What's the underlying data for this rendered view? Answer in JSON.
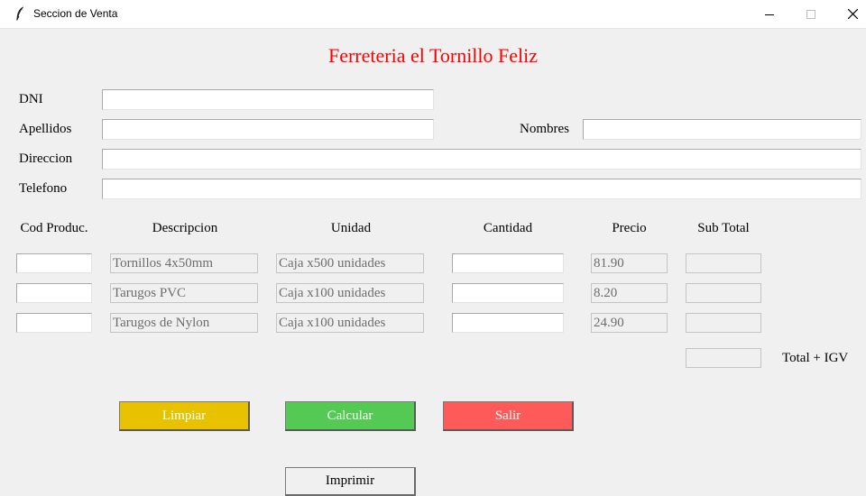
{
  "window": {
    "title": "Seccion de Venta"
  },
  "heading": "Ferreteria el Tornillo Feliz",
  "colors": {
    "heading": "#ff0000",
    "limpiar": "#e8c100",
    "calcular": "#54c954",
    "salir": "#ff5a5a"
  },
  "customer": {
    "dni_label": "DNI",
    "apellidos_label": "Apellidos",
    "nombres_label": "Nombres",
    "direccion_label": "Direccion",
    "telefono_label": "Telefono",
    "dni_value": "",
    "apellidos_value": "",
    "nombres_value": "",
    "direccion_value": "",
    "telefono_value": ""
  },
  "table": {
    "headers": [
      "Cod Produc.",
      "Descripcion",
      "Unidad",
      "Cantidad",
      "Precio",
      "Sub Total"
    ],
    "rows": [
      {
        "cod": "",
        "descripcion": "Tornillos 4x50mm",
        "unidad": "Caja x500 unidades",
        "cantidad": "",
        "precio": "81.90",
        "subtotal": ""
      },
      {
        "cod": "",
        "descripcion": "Tarugos PVC",
        "unidad": "Caja x100 unidades",
        "cantidad": "",
        "precio": "8.20",
        "subtotal": ""
      },
      {
        "cod": "",
        "descripcion": "Tarugos de Nylon",
        "unidad": "Caja x100 unidades",
        "cantidad": "",
        "precio": "24.90",
        "subtotal": ""
      }
    ],
    "total_label": "Total + IGV",
    "total_value": ""
  },
  "buttons": {
    "limpiar": "Limpiar",
    "calcular": "Calcular",
    "salir": "Salir",
    "imprimir": "Imprimir"
  }
}
